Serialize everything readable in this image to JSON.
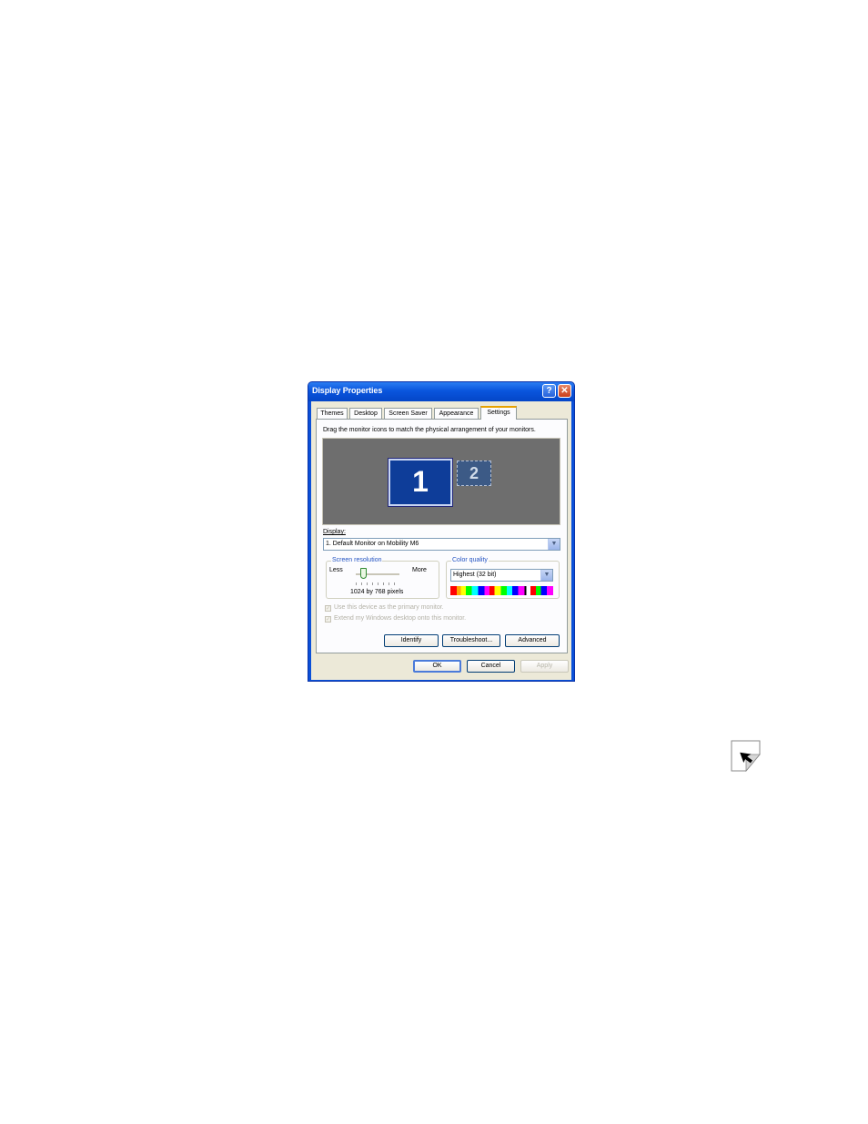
{
  "window": {
    "title": "Display Properties",
    "help_glyph": "?",
    "close_glyph": "✕"
  },
  "tabs": [
    {
      "label": "Themes"
    },
    {
      "label": "Desktop"
    },
    {
      "label": "Screen Saver"
    },
    {
      "label": "Appearance"
    },
    {
      "label": "Settings",
      "active": true
    }
  ],
  "settings": {
    "instruction": "Drag the monitor icons to match the physical arrangement of your monitors.",
    "monitors": [
      {
        "number": "1",
        "selected": true
      },
      {
        "number": "2",
        "selected": false
      }
    ],
    "display_label": "Display:",
    "display_value": "1. Default Monitor on Mobility M6",
    "resolution": {
      "group_label": "Screen resolution",
      "less_label": "Less",
      "more_label": "More",
      "value_text": "1024 by 768 pixels"
    },
    "color_quality": {
      "group_label": "Color quality",
      "value": "Highest (32 bit)"
    },
    "checkboxes": [
      {
        "label": "Use this device as the primary monitor.",
        "checked": true,
        "disabled": true
      },
      {
        "label": "Extend my Windows desktop onto this monitor.",
        "checked": true,
        "disabled": true
      }
    ],
    "buttons": {
      "identify": "Identify",
      "troubleshoot": "Troubleshoot...",
      "advanced": "Advanced"
    }
  },
  "footer": {
    "ok": "OK",
    "cancel": "Cancel",
    "apply": "Apply"
  },
  "colors": {
    "title_bar": "#0a55dd",
    "dialog_face": "#ece9d8",
    "preview_bg": "#6e6e6e",
    "monitor_selected": "#0e3d99"
  },
  "icons": {
    "cursor": "cursor-arrow-icon",
    "dropdown": "chevron-down-icon"
  }
}
